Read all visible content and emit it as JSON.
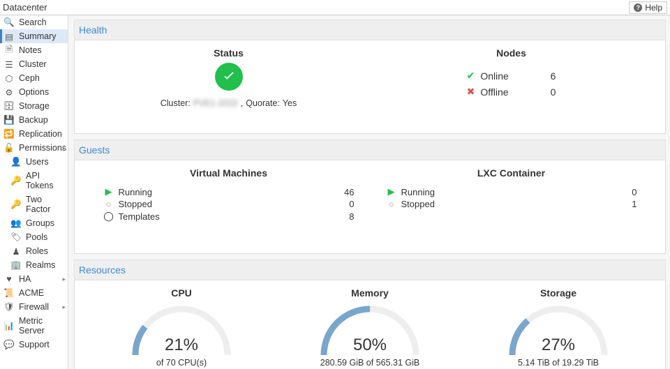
{
  "topbar": {
    "title": "Datacenter",
    "help": "Help"
  },
  "sidebar": {
    "items": [
      {
        "name": "search",
        "label": "Search",
        "icon": "search"
      },
      {
        "name": "summary",
        "label": "Summary",
        "icon": "book",
        "active": true
      },
      {
        "name": "notes",
        "label": "Notes",
        "icon": "note"
      },
      {
        "name": "cluster",
        "label": "Cluster",
        "icon": "cluster"
      },
      {
        "name": "ceph",
        "label": "Ceph",
        "icon": "ceph"
      },
      {
        "name": "options",
        "label": "Options",
        "icon": "gear"
      },
      {
        "name": "storage",
        "label": "Storage",
        "icon": "storage"
      },
      {
        "name": "backup",
        "label": "Backup",
        "icon": "floppy"
      },
      {
        "name": "replication",
        "label": "Replication",
        "icon": "sync"
      },
      {
        "name": "permissions",
        "label": "Permissions",
        "icon": "lock",
        "chevron": true
      },
      {
        "name": "users",
        "label": "Users",
        "icon": "user",
        "sub": true
      },
      {
        "name": "apitokens",
        "label": "API Tokens",
        "icon": "key",
        "sub": true
      },
      {
        "name": "twofactor",
        "label": "Two Factor",
        "icon": "key",
        "sub": true
      },
      {
        "name": "groups",
        "label": "Groups",
        "icon": "users",
        "sub": true
      },
      {
        "name": "pools",
        "label": "Pools",
        "icon": "tags",
        "sub": true
      },
      {
        "name": "roles",
        "label": "Roles",
        "icon": "role",
        "sub": true
      },
      {
        "name": "realms",
        "label": "Realms",
        "icon": "realm",
        "sub": true
      },
      {
        "name": "ha",
        "label": "HA",
        "icon": "heart",
        "chevron": true
      },
      {
        "name": "acme",
        "label": "ACME",
        "icon": "cert"
      },
      {
        "name": "firewall",
        "label": "Firewall",
        "icon": "shield",
        "chevron": true
      },
      {
        "name": "metricserver",
        "label": "Metric Server",
        "icon": "chart"
      },
      {
        "name": "support",
        "label": "Support",
        "icon": "comment"
      }
    ]
  },
  "sections": {
    "health": "Health",
    "guests": "Guests",
    "resources": "Resources"
  },
  "health": {
    "status_title": "Status",
    "cluster_label": "Cluster:",
    "cluster_name_hidden": "PVE1-2022",
    "quorate_label": "Quorate:",
    "quorate_value": "Yes",
    "nodes_title": "Nodes",
    "online_label": "Online",
    "online_count": "6",
    "offline_label": "Offline",
    "offline_count": "0"
  },
  "guests": {
    "vm_title": "Virtual Machines",
    "vm_running_label": "Running",
    "vm_running": "46",
    "vm_stopped_label": "Stopped",
    "vm_stopped": "0",
    "vm_templates_label": "Templates",
    "vm_templates": "8",
    "ct_title": "LXC Container",
    "ct_running_label": "Running",
    "ct_running": "0",
    "ct_stopped_label": "Stopped",
    "ct_stopped": "1"
  },
  "resources": {
    "cpu": {
      "title": "CPU",
      "pct": "21%",
      "pctnum": 21,
      "sub": "of 70 CPU(s)"
    },
    "mem": {
      "title": "Memory",
      "pct": "50%",
      "pctnum": 50,
      "sub": "280.59 GiB of 565.31 GiB"
    },
    "storage": {
      "title": "Storage",
      "pct": "27%",
      "pctnum": 27,
      "sub": "5.14 TiB of 19.29 TiB"
    }
  }
}
